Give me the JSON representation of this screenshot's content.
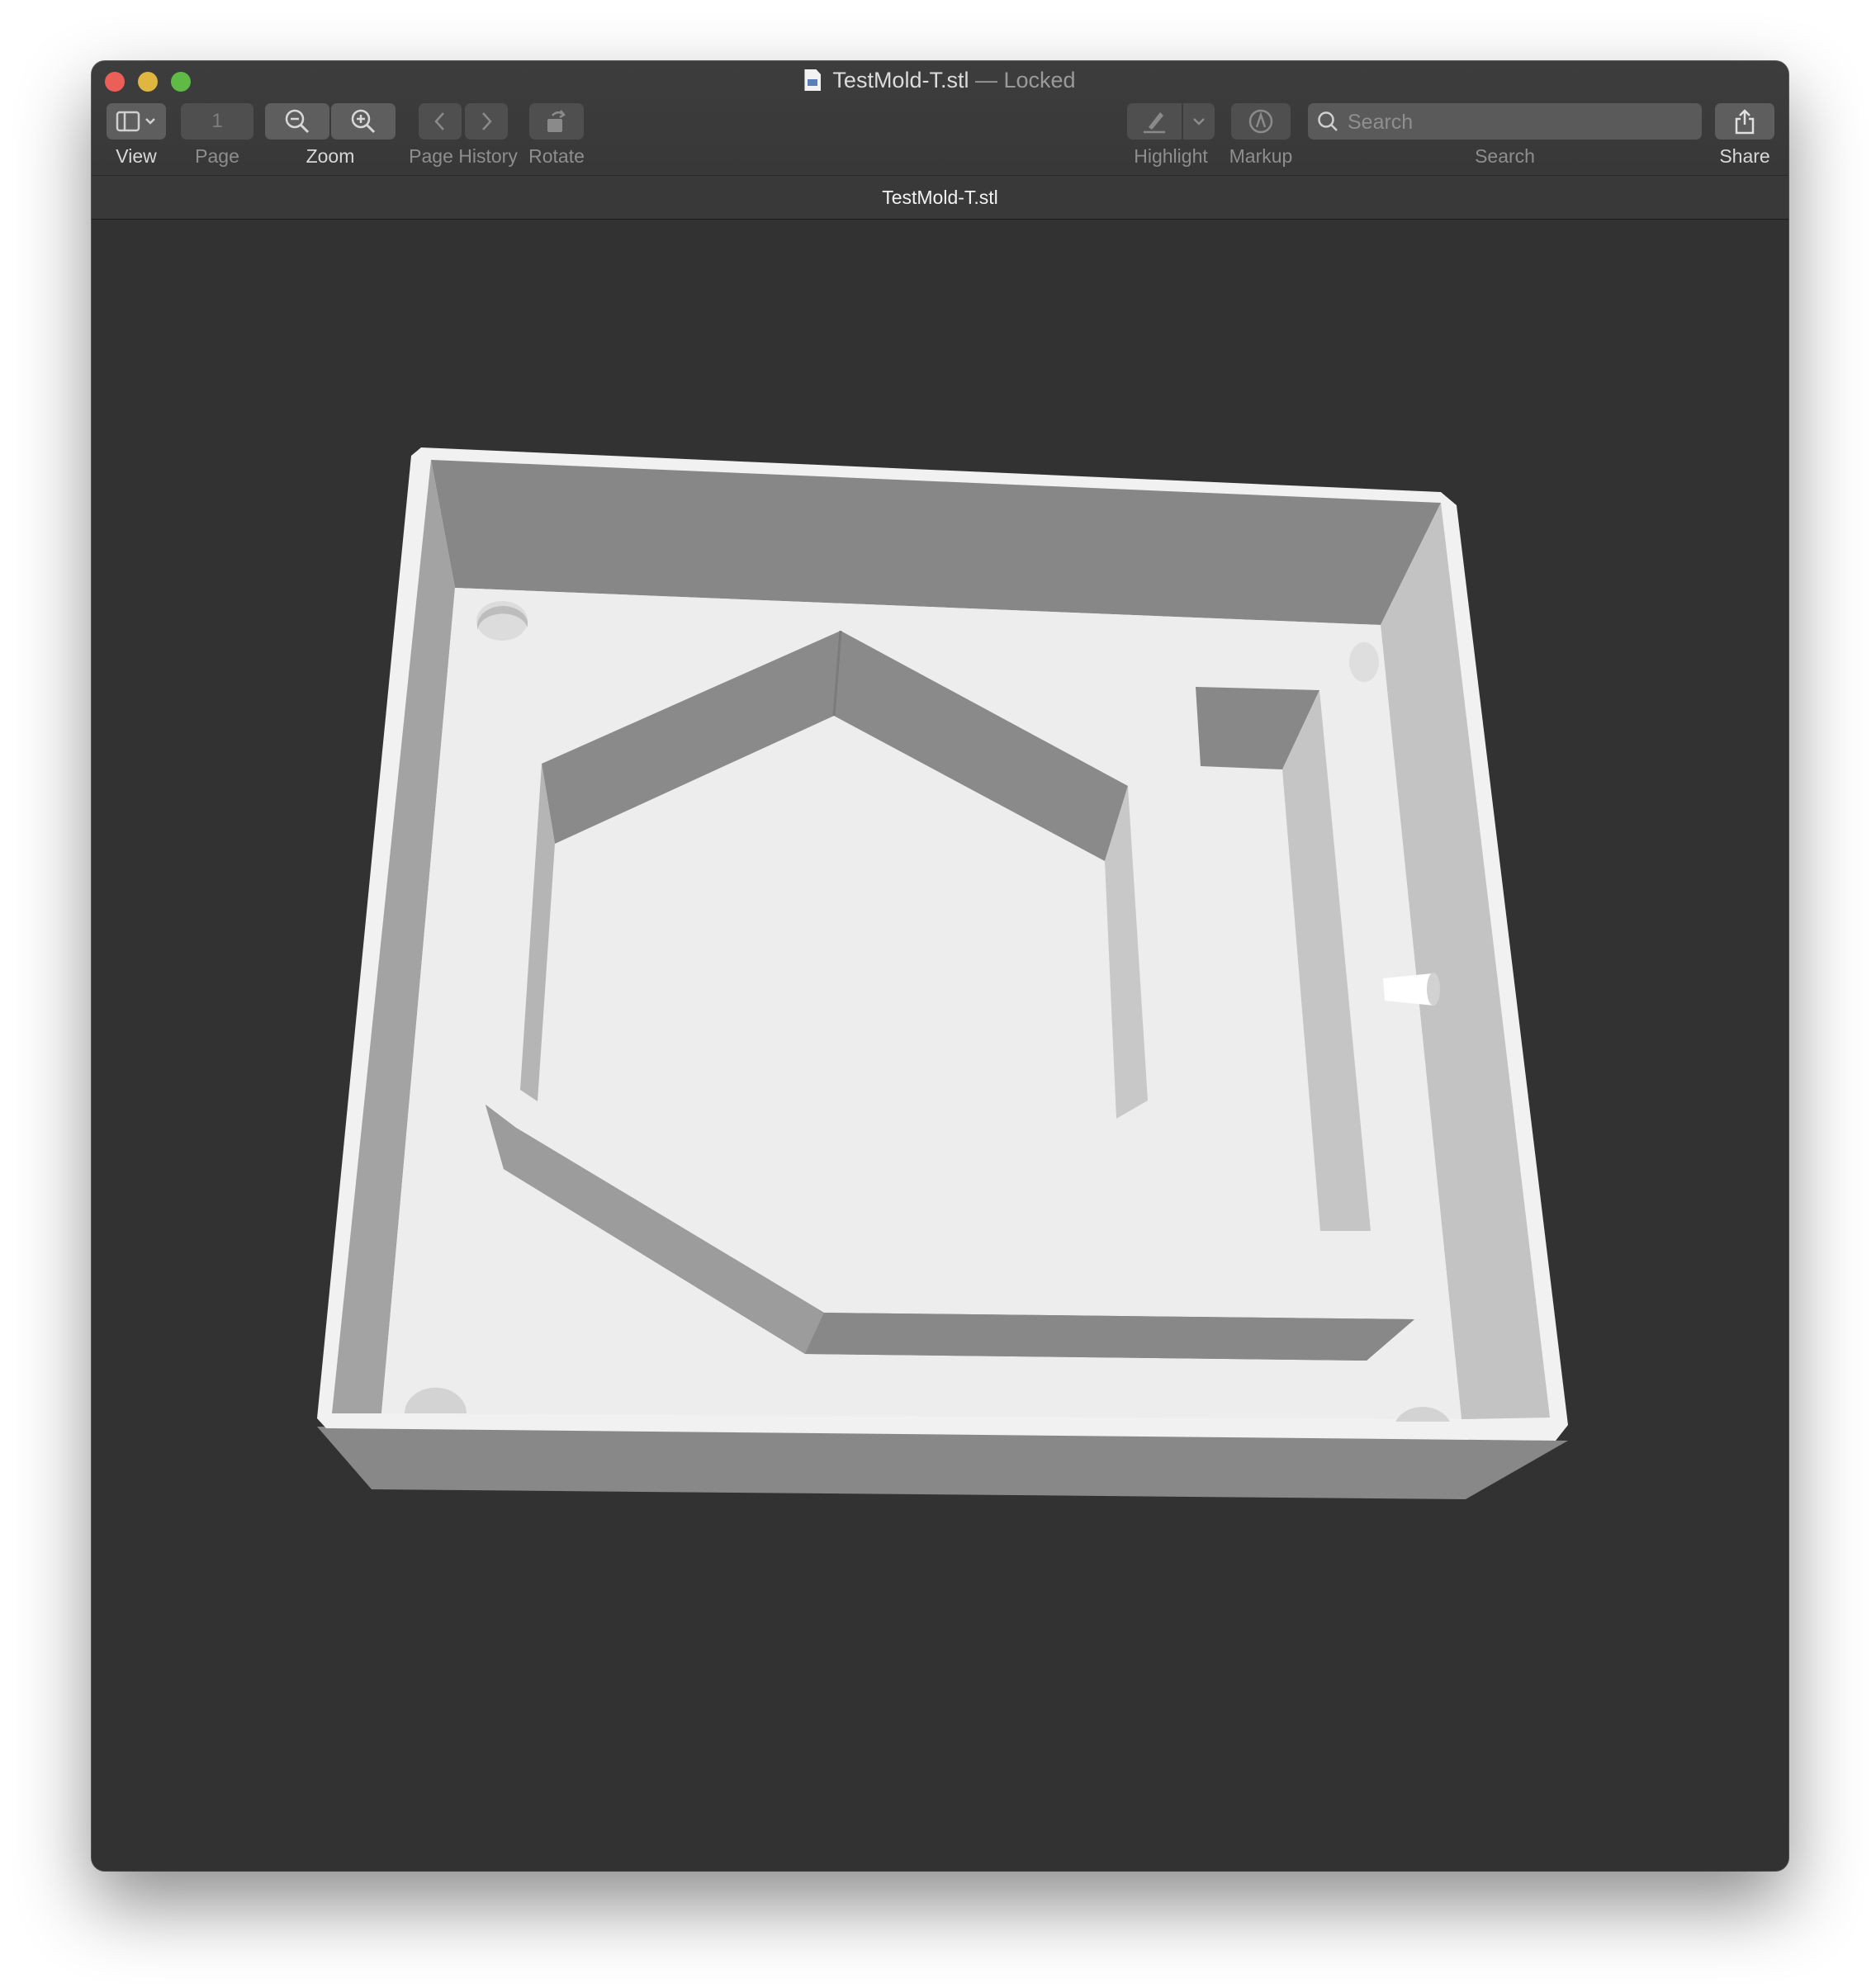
{
  "window": {
    "file_name": "TestMold-T.stl",
    "lock_status": "— Locked"
  },
  "toolbar": {
    "view_label": "View",
    "page_value": "1",
    "page_label": "Page",
    "zoom_label": "Zoom",
    "page_history_label": "Page History",
    "rotate_label": "Rotate",
    "highlight_label": "Highlight",
    "markup_label": "Markup",
    "search_placeholder": "Search",
    "search_value": "",
    "search_label": "Search",
    "share_label": "Share"
  },
  "document": {
    "tab_title": "TestMold-T.stl"
  },
  "colors": {
    "window_bg": "#323232",
    "toolbar_bg": "#3b3b3b",
    "model_top": "#eeeeee",
    "model_wall_dark": "#888888",
    "model_wall_light": "#c4c4c4"
  }
}
